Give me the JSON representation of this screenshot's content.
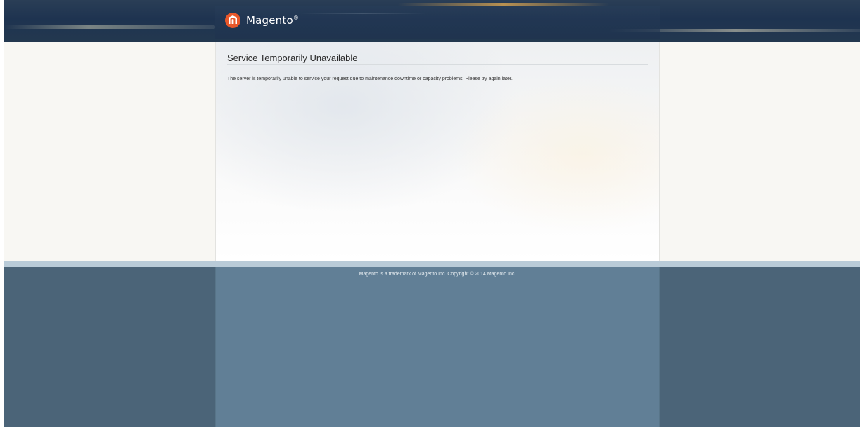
{
  "header": {
    "logo_text": "Magento",
    "logo_mark": "®",
    "logo_icon": "magento-logo-icon",
    "brand_color": "#e8572a"
  },
  "main": {
    "title": "Service Temporarily Unavailable",
    "message": "The server is temporarily unable to service your request due to maintenance downtime or capacity problems. Please try again later."
  },
  "footer": {
    "copyright": "Magento is a trademark of Magento Inc. Copyright © 2014 Magento Inc."
  },
  "colors": {
    "header_bg": "#1e3350",
    "page_bg": "#f8f7f3",
    "footer_bg": "#4b6478",
    "footer_panel": "#617f96",
    "footer_topline": "#b9cbd8"
  }
}
